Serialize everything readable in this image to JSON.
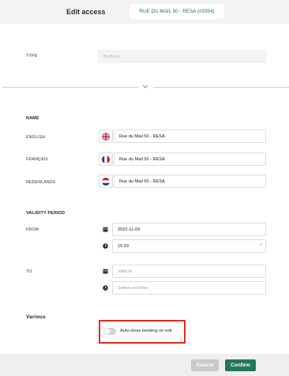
{
  "header": {
    "title": "Edit access",
    "code": "RUE DU MAIL 50 - RESA (#3354)"
  },
  "type_field": {
    "label": "TYPE",
    "value": "Booking"
  },
  "name": {
    "section_title": "NAME",
    "fields": [
      {
        "label": "ENGLISH",
        "value": "Rue du Mail 50 - RESA"
      },
      {
        "label": "FRANÇAIS",
        "value": "Rue du Mail 50 - RESA"
      },
      {
        "label": "NEDERLANDS",
        "value": "Rue du Mail 50 - RESA"
      }
    ]
  },
  "validity": {
    "section_title": "VALIDITY PERIOD",
    "from": {
      "label": "FROM",
      "date": "2022-11-09",
      "time": "15:29"
    },
    "to": {
      "label": "TO",
      "date_placeholder": "Valid to",
      "time_placeholder": "Select end time"
    }
  },
  "various": {
    "section_title": "Various",
    "auto_close_label": "Auto-close booking on exit",
    "auto_close_enabled": false
  },
  "footer": {
    "cancel_label": "Cancel",
    "confirm_label": "Confirm"
  },
  "colors": {
    "accent": "#22795a",
    "highlight": "#e02b20"
  },
  "icons": {
    "clear": "×",
    "chevron": "chevron-down-icon"
  }
}
